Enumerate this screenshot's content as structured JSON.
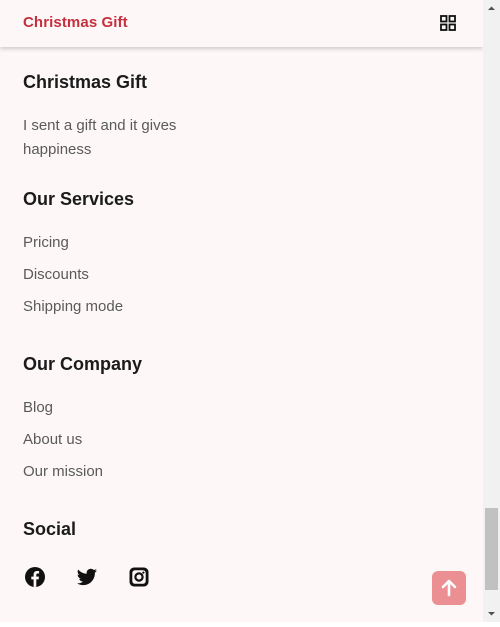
{
  "header": {
    "brand": "Christmas Gift",
    "menu_icon": "grid-icon"
  },
  "about": {
    "title": "Christmas Gift",
    "description": "I sent a gift and it gives happiness"
  },
  "services": {
    "title": "Our Services",
    "links": [
      "Pricing",
      "Discounts",
      "Shipping mode"
    ]
  },
  "company": {
    "title": "Our Company",
    "links": [
      "Blog",
      "About us",
      "Our mission"
    ]
  },
  "social": {
    "title": "Social",
    "icons": [
      "facebook-icon",
      "twitter-icon",
      "instagram-icon"
    ]
  },
  "scroll_top": {
    "icon": "arrow-up-icon"
  },
  "colors": {
    "brand": "#c62f3e",
    "background": "#fdf8f7",
    "scroll_button": "#ec8f93",
    "heading": "#1b1b1b",
    "text": "#5a5a5a"
  }
}
